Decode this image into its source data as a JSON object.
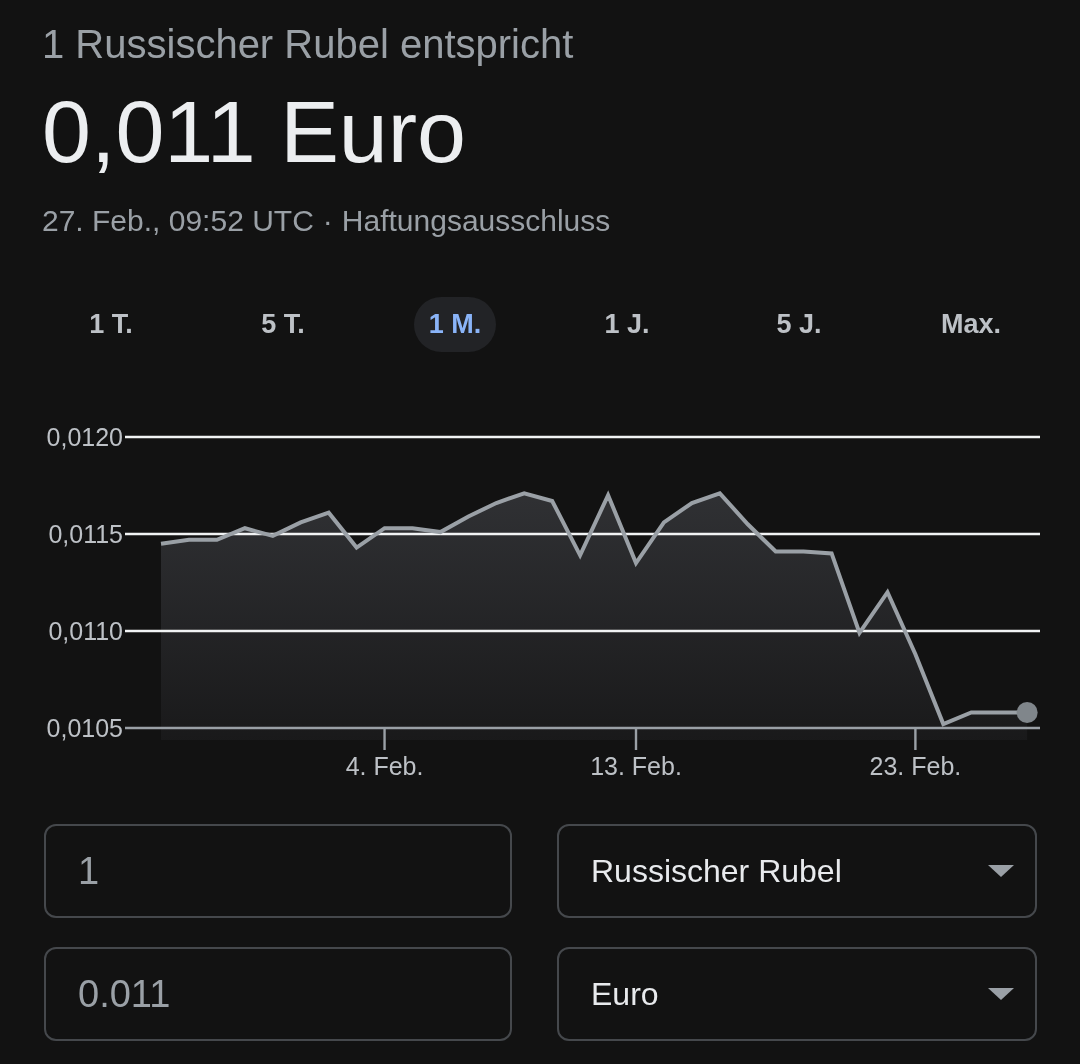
{
  "header": {
    "title": "1 Russischer Rubel entspricht",
    "value": "0,011 Euro",
    "updated": "27. Feb., 09:52 UTC",
    "separator": "·",
    "disclaimer_link": "Haftungsausschluss"
  },
  "range_tabs": [
    {
      "label": "1 T.",
      "selected": false
    },
    {
      "label": "5 T.",
      "selected": false
    },
    {
      "label": "1 M.",
      "selected": true
    },
    {
      "label": "1 J.",
      "selected": false
    },
    {
      "label": "5 J.",
      "selected": false
    },
    {
      "label": "Max.",
      "selected": false
    }
  ],
  "chart": {
    "chart_data": {
      "type": "area",
      "categories": [
        null,
        null,
        null,
        null,
        null,
        null,
        null,
        null,
        "4. Feb.",
        null,
        null,
        null,
        null,
        null,
        null,
        null,
        null,
        "13. Feb.",
        null,
        null,
        null,
        null,
        null,
        null,
        null,
        null,
        null,
        "23. Feb.",
        null,
        null,
        null,
        null
      ],
      "values": [
        0.01145,
        0.01147,
        0.01147,
        0.01153,
        0.01149,
        0.01156,
        0.01161,
        0.01143,
        0.01153,
        0.01153,
        0.01151,
        0.01159,
        0.01166,
        0.01171,
        0.01167,
        0.01139,
        0.0117,
        0.01135,
        0.01156,
        0.01166,
        0.01171,
        0.01155,
        0.01141,
        0.01141,
        0.0114,
        0.01099,
        0.0112,
        0.01088,
        0.01052,
        0.01058,
        0.01058,
        0.01058
      ],
      "ylim": [
        0.0105,
        0.012
      ],
      "yticks": [
        {
          "value": 0.012,
          "label": "0,0120"
        },
        {
          "value": 0.0115,
          "label": "0,0115"
        },
        {
          "value": 0.011,
          "label": "0,0110"
        },
        {
          "value": 0.0105,
          "label": "0,0105"
        }
      ]
    }
  },
  "converter": {
    "rows": [
      {
        "amount": "1",
        "currency": "Russischer Rubel"
      },
      {
        "amount": "0.011",
        "currency": "Euro"
      }
    ]
  }
}
